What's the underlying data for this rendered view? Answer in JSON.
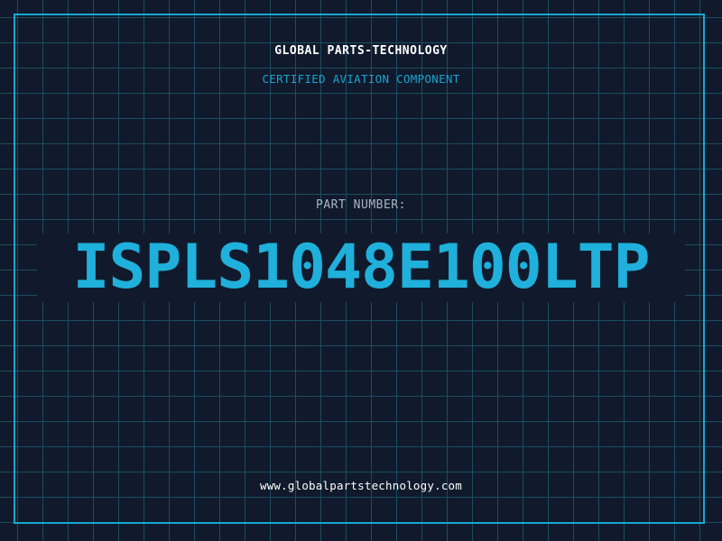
{
  "header": {
    "company": "GLOBAL PARTS-TECHNOLOGY",
    "subtitle": "CERTIFIED AVIATION COMPONENT"
  },
  "part": {
    "label": "PART NUMBER:",
    "number": "ISPLS1048E100LTP"
  },
  "footer": {
    "url": "www.globalpartstechnology.com"
  },
  "colors": {
    "background": "#101a2c",
    "grid": "#1b4d62",
    "frame": "#17a6cf",
    "accent": "#1fb0db",
    "label": "#a8b4c4",
    "text": "#ffffff"
  }
}
